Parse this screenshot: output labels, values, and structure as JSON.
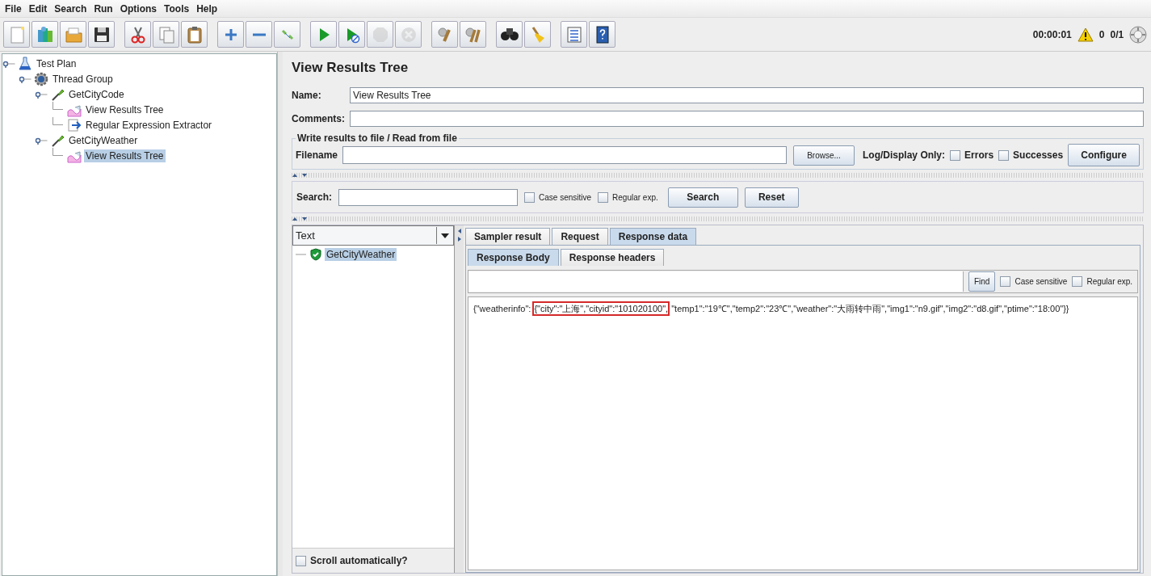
{
  "menu": [
    {
      "label": "File"
    },
    {
      "label": "Edit"
    },
    {
      "label": "Search"
    },
    {
      "label": "Run"
    },
    {
      "label": "Options"
    },
    {
      "label": "Tools"
    },
    {
      "label": "Help"
    }
  ],
  "toolbar": {
    "groups": [
      [
        {
          "disabled": false
        },
        {
          "disabled": false
        },
        {
          "disabled": false
        },
        {
          "disabled": false
        }
      ],
      [
        {
          "disabled": false
        },
        {
          "disabled": false
        },
        {
          "disabled": false
        }
      ],
      [
        {
          "disabled": false
        },
        {
          "disabled": false
        },
        {
          "disabled": false
        }
      ],
      [
        {
          "disabled": false
        },
        {
          "disabled": false
        },
        {
          "disabled": true
        },
        {
          "disabled": true
        }
      ],
      [
        {
          "disabled": false
        },
        {
          "disabled": false
        }
      ],
      [
        {
          "disabled": false
        },
        {
          "disabled": false
        }
      ],
      [
        {
          "disabled": false
        },
        {
          "disabled": false
        }
      ]
    ],
    "timer": "00:00:01",
    "warnings": "0",
    "threads": "0/1"
  },
  "tree": [
    {
      "label": "Test Plan",
      "kind": "test_plan",
      "selected": false,
      "expanded": true,
      "children": [
        {
          "label": "Thread Group",
          "kind": "thread_group",
          "selected": false,
          "expanded": true,
          "children": [
            {
              "label": "GetCityCode",
              "kind": "sampler",
              "selected": false,
              "expanded": true,
              "children": [
                {
                  "label": "View Results Tree",
                  "kind": "listener",
                  "selected": false
                },
                {
                  "label": "Regular Expression Extractor",
                  "kind": "extractor",
                  "selected": false
                }
              ]
            },
            {
              "label": "GetCityWeather",
              "kind": "sampler",
              "selected": false,
              "expanded": true,
              "children": [
                {
                  "label": "View Results Tree",
                  "kind": "listener",
                  "selected": true
                }
              ]
            }
          ]
        }
      ]
    }
  ],
  "results": {
    "title": "View Results Tree",
    "name_label": "Name:",
    "name_value": "View Results Tree",
    "comments_label": "Comments:",
    "file_group": {
      "legend": "Write results to file / Read from file",
      "filename_label": "Filename",
      "browse": "Browse...",
      "log_label": "Log/Display Only:",
      "errors": {
        "label": "Errors",
        "checked": false
      },
      "successes": {
        "label": "Successes",
        "checked": false
      },
      "configure": "Configure"
    },
    "search": {
      "label": "Search:",
      "case_sensitive": {
        "label": "Case sensitive",
        "checked": false
      },
      "regex": {
        "label": "Regular exp.",
        "checked": false
      },
      "search_button": "Search",
      "reset_button": "Reset"
    },
    "renderer": "Text",
    "samples": [
      {
        "label": "GetCityWeather",
        "kind": "success",
        "selected": true
      }
    ],
    "scroll": {
      "label": "Scroll automatically?",
      "checked": false
    },
    "tabs": [
      {
        "label": "Sampler result",
        "selected": false
      },
      {
        "label": "Request",
        "selected": false
      },
      {
        "label": "Response data",
        "selected": true
      }
    ],
    "subtabs": [
      {
        "label": "Response Body",
        "selected": true
      },
      {
        "label": "Response headers",
        "selected": false
      }
    ],
    "find": {
      "button": "Find",
      "case_sensitive": {
        "label": "Case sensitive",
        "checked": false
      },
      "regex": {
        "label": "Regular exp.",
        "checked": false
      }
    },
    "response_segments": [
      {
        "text": "{\"weatherinfo\":",
        "highlighted": false
      },
      {
        "text": "{\"city\":\"上海\",\"cityid\":\"101020100\",",
        "highlighted": true
      },
      {
        "text": "\"temp1\":\"19℃\",\"temp2\":\"23℃\",\"weather\":\"大雨转中雨\",\"img1\":\"n9.gif\",\"img2\":\"d8.gif\",\"ptime\":\"18:00\"}}",
        "highlighted": false
      }
    ]
  }
}
